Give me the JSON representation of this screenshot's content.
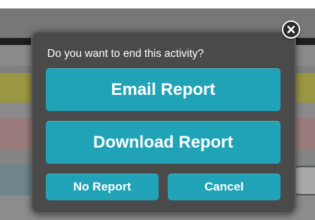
{
  "dialog": {
    "question": "Do you want to end this activity?",
    "buttons": {
      "email_report": "Email Report",
      "download_report": "Download Report",
      "no_report": "No Report",
      "cancel": "Cancel"
    },
    "close_icon": "close-icon"
  },
  "colors": {
    "accent": "#21a3b7",
    "dialog_bg": "#4a4a4a",
    "text": "#ffffff"
  }
}
